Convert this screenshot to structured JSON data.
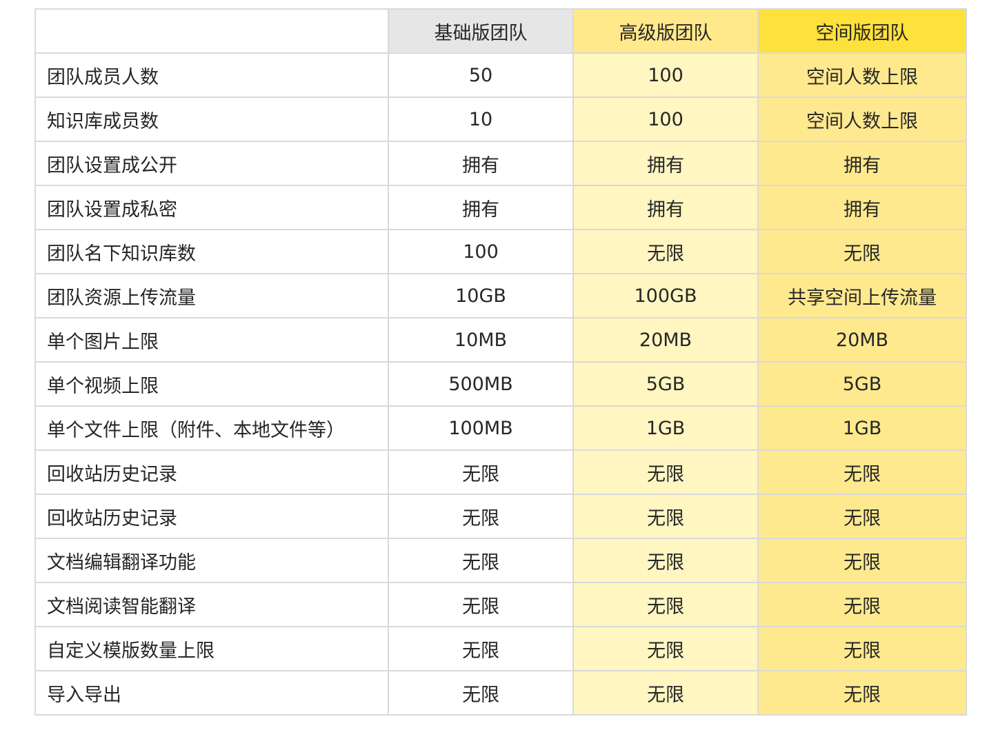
{
  "table": {
    "headers": [
      "",
      "基础版团队",
      "高级版团队",
      "空间版团队"
    ],
    "rows": [
      [
        "团队成员人数",
        "50",
        "100",
        "空间人数上限"
      ],
      [
        "知识库成员数",
        "10",
        "100",
        "空间人数上限"
      ],
      [
        "团队设置成公开",
        "拥有",
        "拥有",
        "拥有"
      ],
      [
        "团队设置成私密",
        "拥有",
        "拥有",
        "拥有"
      ],
      [
        "团队名下知识库数",
        "100",
        "无限",
        "无限"
      ],
      [
        "团队资源上传流量",
        "10GB",
        "100GB",
        "共享空间上传流量"
      ],
      [
        "单个图片上限",
        "10MB",
        "20MB",
        "20MB"
      ],
      [
        "单个视频上限",
        "500MB",
        "5GB",
        "5GB"
      ],
      [
        "单个文件上限（附件、本地文件等）",
        "100MB",
        "1GB",
        "1GB"
      ],
      [
        "回收站历史记录",
        "无限",
        "无限",
        "无限"
      ],
      [
        "回收站历史记录",
        "无限",
        "无限",
        "无限"
      ],
      [
        "文档编辑翻译功能",
        "无限",
        "无限",
        "无限"
      ],
      [
        "文档阅读智能翻译",
        "无限",
        "无限",
        "无限"
      ],
      [
        "自定义模版数量上限",
        "无限",
        "无限",
        "无限"
      ],
      [
        "导入导出",
        "无限",
        "无限",
        "无限"
      ]
    ]
  },
  "colors": {
    "border": "#d9d9d9",
    "header_basic_bg": "#e6e6e6",
    "header_advanced_bg": "#ffe98a",
    "header_space_bg": "#ffe13b",
    "cell_advanced_bg": "#fff6c2",
    "cell_space_bg": "#ffe98f"
  }
}
